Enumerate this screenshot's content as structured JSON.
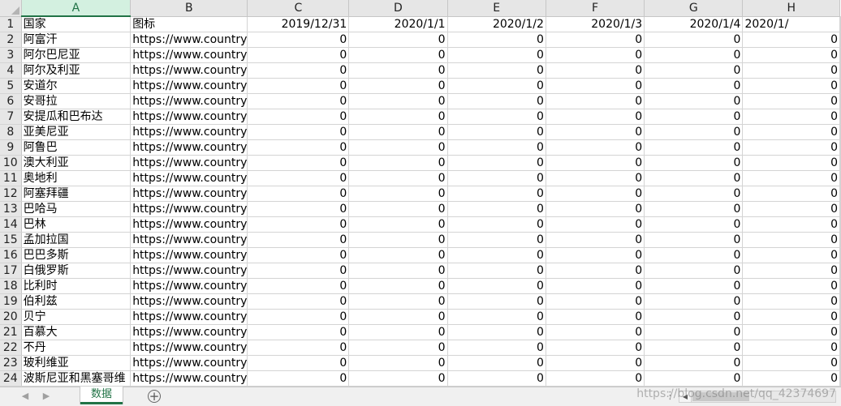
{
  "columns": [
    "A",
    "B",
    "C",
    "D",
    "E",
    "F",
    "G",
    "H"
  ],
  "header_row": {
    "num": "1",
    "a": "国家",
    "b": "图标",
    "dates": [
      "2019/12/31",
      "2020/1/1",
      "2020/1/2",
      "2020/1/3",
      "2020/1/4",
      "2020/1/"
    ]
  },
  "rows": [
    {
      "num": "2",
      "country": "阿富汗",
      "icon": "https://www.country",
      "vals": [
        "0",
        "0",
        "0",
        "0",
        "0",
        "0"
      ]
    },
    {
      "num": "3",
      "country": "阿尔巴尼亚",
      "icon": "https://www.country",
      "vals": [
        "0",
        "0",
        "0",
        "0",
        "0",
        "0"
      ]
    },
    {
      "num": "4",
      "country": "阿尔及利亚",
      "icon": "https://www.country",
      "vals": [
        "0",
        "0",
        "0",
        "0",
        "0",
        "0"
      ]
    },
    {
      "num": "5",
      "country": "安道尔",
      "icon": "https://www.country",
      "vals": [
        "0",
        "0",
        "0",
        "0",
        "0",
        "0"
      ]
    },
    {
      "num": "6",
      "country": "安哥拉",
      "icon": "https://www.country",
      "vals": [
        "0",
        "0",
        "0",
        "0",
        "0",
        "0"
      ]
    },
    {
      "num": "7",
      "country": "安提瓜和巴布达",
      "icon": "https://www.country",
      "vals": [
        "0",
        "0",
        "0",
        "0",
        "0",
        "0"
      ]
    },
    {
      "num": "8",
      "country": "亚美尼亚",
      "icon": "https://www.country",
      "vals": [
        "0",
        "0",
        "0",
        "0",
        "0",
        "0"
      ]
    },
    {
      "num": "9",
      "country": "阿鲁巴",
      "icon": "https://www.country",
      "vals": [
        "0",
        "0",
        "0",
        "0",
        "0",
        "0"
      ]
    },
    {
      "num": "10",
      "country": "澳大利亚",
      "icon": "https://www.country",
      "vals": [
        "0",
        "0",
        "0",
        "0",
        "0",
        "0"
      ]
    },
    {
      "num": "11",
      "country": "奥地利",
      "icon": "https://www.country",
      "vals": [
        "0",
        "0",
        "0",
        "0",
        "0",
        "0"
      ]
    },
    {
      "num": "12",
      "country": "阿塞拜疆",
      "icon": "https://www.country",
      "vals": [
        "0",
        "0",
        "0",
        "0",
        "0",
        "0"
      ]
    },
    {
      "num": "13",
      "country": "巴哈马",
      "icon": "https://www.country",
      "vals": [
        "0",
        "0",
        "0",
        "0",
        "0",
        "0"
      ]
    },
    {
      "num": "14",
      "country": "巴林",
      "icon": "https://www.country",
      "vals": [
        "0",
        "0",
        "0",
        "0",
        "0",
        "0"
      ]
    },
    {
      "num": "15",
      "country": "孟加拉国",
      "icon": "https://www.country",
      "vals": [
        "0",
        "0",
        "0",
        "0",
        "0",
        "0"
      ]
    },
    {
      "num": "16",
      "country": "巴巴多斯",
      "icon": "https://www.country",
      "vals": [
        "0",
        "0",
        "0",
        "0",
        "0",
        "0"
      ]
    },
    {
      "num": "17",
      "country": "白俄罗斯",
      "icon": "https://www.country",
      "vals": [
        "0",
        "0",
        "0",
        "0",
        "0",
        "0"
      ]
    },
    {
      "num": "18",
      "country": "比利时",
      "icon": "https://www.country",
      "vals": [
        "0",
        "0",
        "0",
        "0",
        "0",
        "0"
      ]
    },
    {
      "num": "19",
      "country": "伯利兹",
      "icon": "https://www.country",
      "vals": [
        "0",
        "0",
        "0",
        "0",
        "0",
        "0"
      ]
    },
    {
      "num": "20",
      "country": "贝宁",
      "icon": "https://www.country",
      "vals": [
        "0",
        "0",
        "0",
        "0",
        "0",
        "0"
      ]
    },
    {
      "num": "21",
      "country": "百慕大",
      "icon": "https://www.country",
      "vals": [
        "0",
        "0",
        "0",
        "0",
        "0",
        "0"
      ]
    },
    {
      "num": "22",
      "country": "不丹",
      "icon": "https://www.country",
      "vals": [
        "0",
        "0",
        "0",
        "0",
        "0",
        "0"
      ]
    },
    {
      "num": "23",
      "country": "玻利维亚",
      "icon": "https://www.country",
      "vals": [
        "0",
        "0",
        "0",
        "0",
        "0",
        "0"
      ]
    },
    {
      "num": "24",
      "country": "波斯尼亚和黑塞哥维",
      "icon": "https://www.country",
      "vals": [
        "0",
        "0",
        "0",
        "0",
        "0",
        "0"
      ]
    }
  ],
  "tabs": {
    "active": "数据",
    "prev_icon": "triangle-left-icon",
    "next_icon": "triangle-right-icon",
    "add_icon": "plus-circle-icon",
    "add_glyph": "+",
    "separator": "⋮"
  },
  "watermark": "https://blog.csdn.net/qq_42374697",
  "colors": {
    "accent": "#217346",
    "header_bg": "#e6e6e6",
    "grid_line": "#d4d4d4"
  }
}
